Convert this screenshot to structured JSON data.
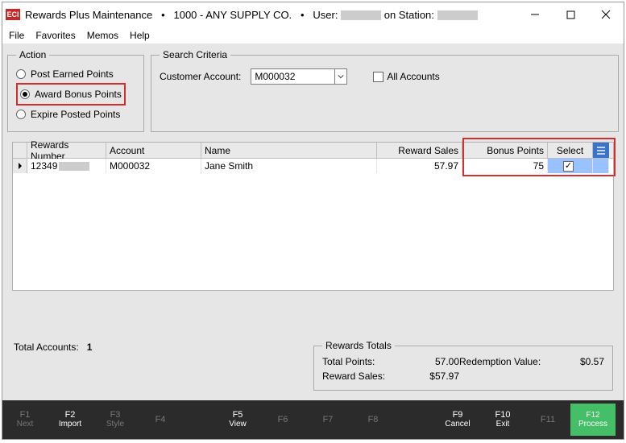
{
  "title": {
    "app": "Rewards Plus Maintenance",
    "company": "1000 - ANY SUPPLY CO.",
    "user_label": "User:",
    "station_label": "on Station:"
  },
  "eci_badge": "ECI",
  "menu": {
    "file": "File",
    "favorites": "Favorites",
    "memos": "Memos",
    "help": "Help"
  },
  "action": {
    "legend": "Action",
    "post": "Post Earned Points",
    "award": "Award Bonus Points",
    "expire": "Expire Posted Points",
    "selected": "award"
  },
  "search": {
    "legend": "Search Criteria",
    "account_label": "Customer Account:",
    "account_value": "M000032",
    "all_accounts_label": "All Accounts",
    "all_accounts_checked": false
  },
  "grid": {
    "columns": {
      "rewards": "Rewards Number",
      "account": "Account",
      "name": "Name",
      "sales": "Reward Sales",
      "bonus": "Bonus Points",
      "select": "Select"
    },
    "rows": [
      {
        "rewards": "12349",
        "account": "M000032",
        "name": "Jane Smith",
        "sales": "57.97",
        "bonus": "75",
        "selected": true
      }
    ]
  },
  "totals": {
    "accounts_label": "Total Accounts:",
    "accounts_value": "1",
    "legend": "Rewards Totals",
    "points_label": "Total Points:",
    "points_value": "57.00",
    "redemption_label": "Redemption Value:",
    "redemption_value": "$0.57",
    "sales_label": "Reward Sales:",
    "sales_value": "$57.97"
  },
  "fkeys": {
    "f1": "Next",
    "f2": "Import",
    "f3": "Style",
    "f4": "",
    "f5": "View",
    "f6": "",
    "f7": "",
    "f8": "",
    "f9": "Cancel",
    "f10": "Exit",
    "f11": "",
    "f12": "Process"
  }
}
